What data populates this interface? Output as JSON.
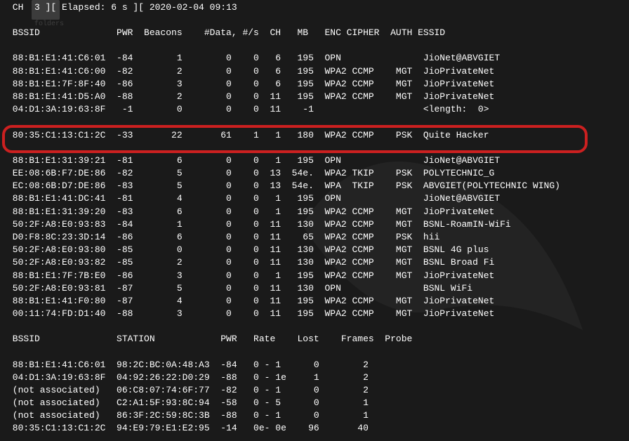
{
  "folder_label": "folders",
  "status_line": " CH  3 ][ Elapsed: 6 s ][ 2020-02-04 09:13",
  "bssid_header": " BSSID              PWR  Beacons    #Data, #/s  CH   MB   ENC CIPHER  AUTH ESSID",
  "station_header": " BSSID              STATION            PWR   Rate    Lost    Frames  Probe",
  "networks": [
    {
      "bssid": "88:B1:E1:41:C6:01",
      "pwr": "-84",
      "beacons": "1",
      "data": "0",
      "ps": "0",
      "ch": "6",
      "mb": "195",
      "enc": "OPN",
      "cipher": "",
      "auth": "",
      "essid": "JioNet@ABVGIET"
    },
    {
      "bssid": "88:B1:E1:41:C6:00",
      "pwr": "-82",
      "beacons": "2",
      "data": "0",
      "ps": "0",
      "ch": "6",
      "mb": "195",
      "enc": "WPA2",
      "cipher": "CCMP",
      "auth": "MGT",
      "essid": "JioPrivateNet"
    },
    {
      "bssid": "88:B1:E1:7F:8F:40",
      "pwr": "-86",
      "beacons": "3",
      "data": "0",
      "ps": "0",
      "ch": "6",
      "mb": "195",
      "enc": "WPA2",
      "cipher": "CCMP",
      "auth": "MGT",
      "essid": "JioPrivateNet"
    },
    {
      "bssid": "88:B1:E1:41:D5:A0",
      "pwr": "-88",
      "beacons": "2",
      "data": "0",
      "ps": "0",
      "ch": "11",
      "mb": "195",
      "enc": "WPA2",
      "cipher": "CCMP",
      "auth": "MGT",
      "essid": "JioPrivateNet"
    },
    {
      "bssid": "04:D1:3A:19:63:8F",
      "pwr": "-1",
      "beacons": "0",
      "data": "0",
      "ps": "0",
      "ch": "11",
      "mb": "-1",
      "enc": "",
      "cipher": "",
      "auth": "",
      "essid": "<length:  0>"
    },
    {
      "bssid": "               ",
      "pwr": "",
      "beacons": "",
      "data": "",
      "ps": "",
      "ch": "",
      "mb": "",
      "enc": "",
      "cipher": "",
      "auth": "",
      "essid": ""
    },
    {
      "bssid": "80:35:C1:13:C1:2C",
      "pwr": "-33",
      "beacons": "22",
      "data": "61",
      "ps": "1",
      "ch": "1",
      "mb": "180",
      "enc": "WPA2",
      "cipher": "CCMP",
      "auth": "PSK",
      "essid": "Quite Hacker"
    },
    {
      "bssid": "               ",
      "pwr": "",
      "beacons": "",
      "data": "",
      "ps": "",
      "ch": "",
      "mb": "",
      "enc": "",
      "cipher": "",
      "auth": "",
      "essid": ""
    },
    {
      "bssid": "88:B1:E1:31:39:21",
      "pwr": "-81",
      "beacons": "6",
      "data": "0",
      "ps": "0",
      "ch": "1",
      "mb": "195",
      "enc": "OPN",
      "cipher": "",
      "auth": "",
      "essid": "JioNet@ABVGIET"
    },
    {
      "bssid": "EE:08:6B:F7:DE:86",
      "pwr": "-82",
      "beacons": "5",
      "data": "0",
      "ps": "0",
      "ch": "13",
      "mb": "54e.",
      "enc": "WPA2",
      "cipher": "TKIP",
      "auth": "PSK",
      "essid": "POLYTECHNIC_G"
    },
    {
      "bssid": "EC:08:6B:D7:DE:86",
      "pwr": "-83",
      "beacons": "5",
      "data": "0",
      "ps": "0",
      "ch": "13",
      "mb": "54e.",
      "enc": "WPA",
      "cipher": "TKIP",
      "auth": "PSK",
      "essid": "ABVGIET(POLYTECHNIC WING)"
    },
    {
      "bssid": "88:B1:E1:41:DC:41",
      "pwr": "-81",
      "beacons": "4",
      "data": "0",
      "ps": "0",
      "ch": "1",
      "mb": "195",
      "enc": "OPN",
      "cipher": "",
      "auth": "",
      "essid": "JioNet@ABVGIET"
    },
    {
      "bssid": "88:B1:E1:31:39:20",
      "pwr": "-83",
      "beacons": "6",
      "data": "0",
      "ps": "0",
      "ch": "1",
      "mb": "195",
      "enc": "WPA2",
      "cipher": "CCMP",
      "auth": "MGT",
      "essid": "JioPrivateNet"
    },
    {
      "bssid": "50:2F:A8:E0:93:83",
      "pwr": "-84",
      "beacons": "1",
      "data": "0",
      "ps": "0",
      "ch": "11",
      "mb": "130",
      "enc": "WPA2",
      "cipher": "CCMP",
      "auth": "MGT",
      "essid": "BSNL-RoamIN-WiFi"
    },
    {
      "bssid": "D0:F8:8C:23:3D:14",
      "pwr": "-86",
      "beacons": "6",
      "data": "0",
      "ps": "0",
      "ch": "11",
      "mb": "65",
      "enc": "WPA2",
      "cipher": "CCMP",
      "auth": "PSK",
      "essid": "hii"
    },
    {
      "bssid": "50:2F:A8:E0:93:80",
      "pwr": "-85",
      "beacons": "0",
      "data": "0",
      "ps": "0",
      "ch": "11",
      "mb": "130",
      "enc": "WPA2",
      "cipher": "CCMP",
      "auth": "MGT",
      "essid": "BSNL 4G plus"
    },
    {
      "bssid": "50:2F:A8:E0:93:82",
      "pwr": "-85",
      "beacons": "2",
      "data": "0",
      "ps": "0",
      "ch": "11",
      "mb": "130",
      "enc": "WPA2",
      "cipher": "CCMP",
      "auth": "MGT",
      "essid": "BSNL Broad Fi"
    },
    {
      "bssid": "88:B1:E1:7F:7B:E0",
      "pwr": "-86",
      "beacons": "3",
      "data": "0",
      "ps": "0",
      "ch": "1",
      "mb": "195",
      "enc": "WPA2",
      "cipher": "CCMP",
      "auth": "MGT",
      "essid": "JioPrivateNet"
    },
    {
      "bssid": "50:2F:A8:E0:93:81",
      "pwr": "-87",
      "beacons": "5",
      "data": "0",
      "ps": "0",
      "ch": "11",
      "mb": "130",
      "enc": "OPN",
      "cipher": "",
      "auth": "",
      "essid": "BSNL WiFi"
    },
    {
      "bssid": "88:B1:E1:41:F0:80",
      "pwr": "-87",
      "beacons": "4",
      "data": "0",
      "ps": "0",
      "ch": "11",
      "mb": "195",
      "enc": "WPA2",
      "cipher": "CCMP",
      "auth": "MGT",
      "essid": "JioPrivateNet"
    },
    {
      "bssid": "00:11:74:FD:D1:40",
      "pwr": "-88",
      "beacons": "3",
      "data": "0",
      "ps": "0",
      "ch": "11",
      "mb": "195",
      "enc": "WPA2",
      "cipher": "CCMP",
      "auth": "MGT",
      "essid": "JioPrivateNet"
    }
  ],
  "stations": [
    {
      "bssid": "88:B1:E1:41:C6:01",
      "station": "98:2C:BC:0A:48:A3",
      "pwr": "-84",
      "rate": "0 - 1",
      "lost": "0",
      "frames": "2",
      "probe": ""
    },
    {
      "bssid": "04:D1:3A:19:63:8F",
      "station": "04:92:26:22:D0:29",
      "pwr": "-88",
      "rate": "0 - 1e",
      "lost": "1",
      "frames": "2",
      "probe": ""
    },
    {
      "bssid": "(not associated)",
      "station": "06:C8:07:74:6F:77",
      "pwr": "-82",
      "rate": "0 - 1",
      "lost": "0",
      "frames": "2",
      "probe": ""
    },
    {
      "bssid": "(not associated)",
      "station": "C2:A1:5F:93:8C:94",
      "pwr": "-58",
      "rate": "0 - 5",
      "lost": "0",
      "frames": "1",
      "probe": ""
    },
    {
      "bssid": "(not associated)",
      "station": "86:3F:2C:59:8C:3B",
      "pwr": "-88",
      "rate": "0 - 1",
      "lost": "0",
      "frames": "1",
      "probe": ""
    },
    {
      "bssid": "80:35:C1:13:C1:2C",
      "station": "94:E9:79:E1:E2:95",
      "pwr": "-14",
      "rate": "0e- 0e",
      "lost": "96",
      "frames": "40",
      "probe": ""
    }
  ]
}
